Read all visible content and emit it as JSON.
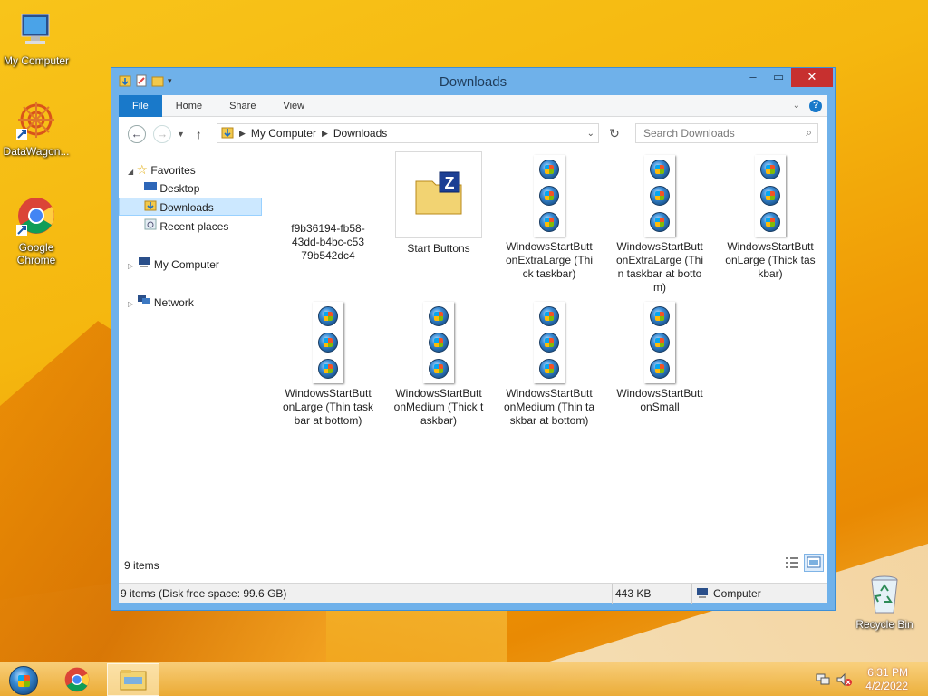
{
  "desktop": {
    "icons": [
      {
        "label": "My Computer"
      },
      {
        "label": "DataWagon..."
      },
      {
        "label": "Google Chrome"
      },
      {
        "label": "Recycle Bin"
      }
    ]
  },
  "window": {
    "title": "Downloads",
    "ribbon_tabs": [
      "File",
      "Home",
      "Share",
      "View"
    ],
    "address": {
      "crumbs": [
        "My Computer",
        "Downloads"
      ]
    },
    "search_placeholder": "Search Downloads",
    "nav": {
      "favorites": "Favorites",
      "desktop": "Desktop",
      "downloads": "Downloads",
      "recent": "Recent places",
      "computer": "My Computer",
      "network": "Network"
    },
    "files": [
      {
        "name": "f9b36194-fb58-43dd-b4bc-c5379b542dc4",
        "kind": "blank"
      },
      {
        "name": "Start Buttons",
        "kind": "zip"
      },
      {
        "name": "WindowsStartButtonExtraLarge (Thick taskbar)",
        "kind": "orbs"
      },
      {
        "name": "WindowsStartButtonExtraLarge (Thin taskbar at bottom)",
        "kind": "orbs"
      },
      {
        "name": "WindowsStartButtonLarge (Thick taskbar)",
        "kind": "orbs"
      },
      {
        "name": "WindowsStartButtonLarge (Thin taskbar at bottom)",
        "kind": "orbs"
      },
      {
        "name": "WindowsStartButtonMedium (Thick taskbar)",
        "kind": "orbs"
      },
      {
        "name": "WindowsStartButtonMedium (Thin taskbar at bottom)",
        "kind": "orbs"
      },
      {
        "name": "WindowsStartButtonSmall",
        "kind": "orbs"
      }
    ],
    "item_count": "9 items",
    "status": {
      "left": "9 items (Disk free space: 99.6 GB)",
      "size": "443 KB",
      "location": "Computer"
    }
  },
  "taskbar": {
    "time": "6:31 PM",
    "date": "4/2/2022"
  },
  "colors": {
    "accent": "#1979ca",
    "close": "#c7302f",
    "selection": "#cce8ff"
  }
}
